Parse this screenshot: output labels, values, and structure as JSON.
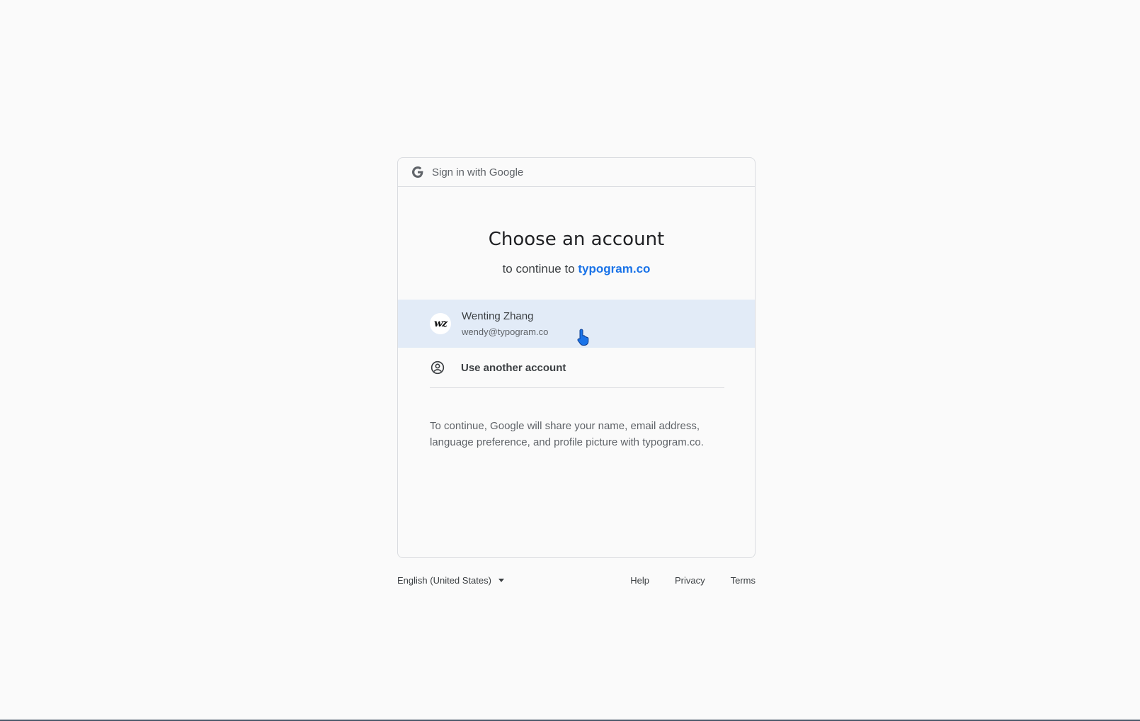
{
  "header": {
    "text": "Sign in with Google",
    "icon": "google-g-icon"
  },
  "main": {
    "title": "Choose an account",
    "subtitle_prefix": "to continue to",
    "site": "typogram.co"
  },
  "account": {
    "avatar_text": "wz",
    "name": "Wenting Zhang",
    "email": "wendy@typogram.co"
  },
  "another": {
    "label": "Use another account",
    "icon": "person-circle-icon"
  },
  "notice": "To continue, Google will share your name, email address, language preference, and profile picture with typogram.co.",
  "footer": {
    "language": "English (United States)",
    "links": [
      "Help",
      "Privacy",
      "Terms"
    ]
  },
  "colors": {
    "accent": "#1a73e8",
    "selected_row": "#e2ebf7",
    "border": "#dadce0"
  }
}
